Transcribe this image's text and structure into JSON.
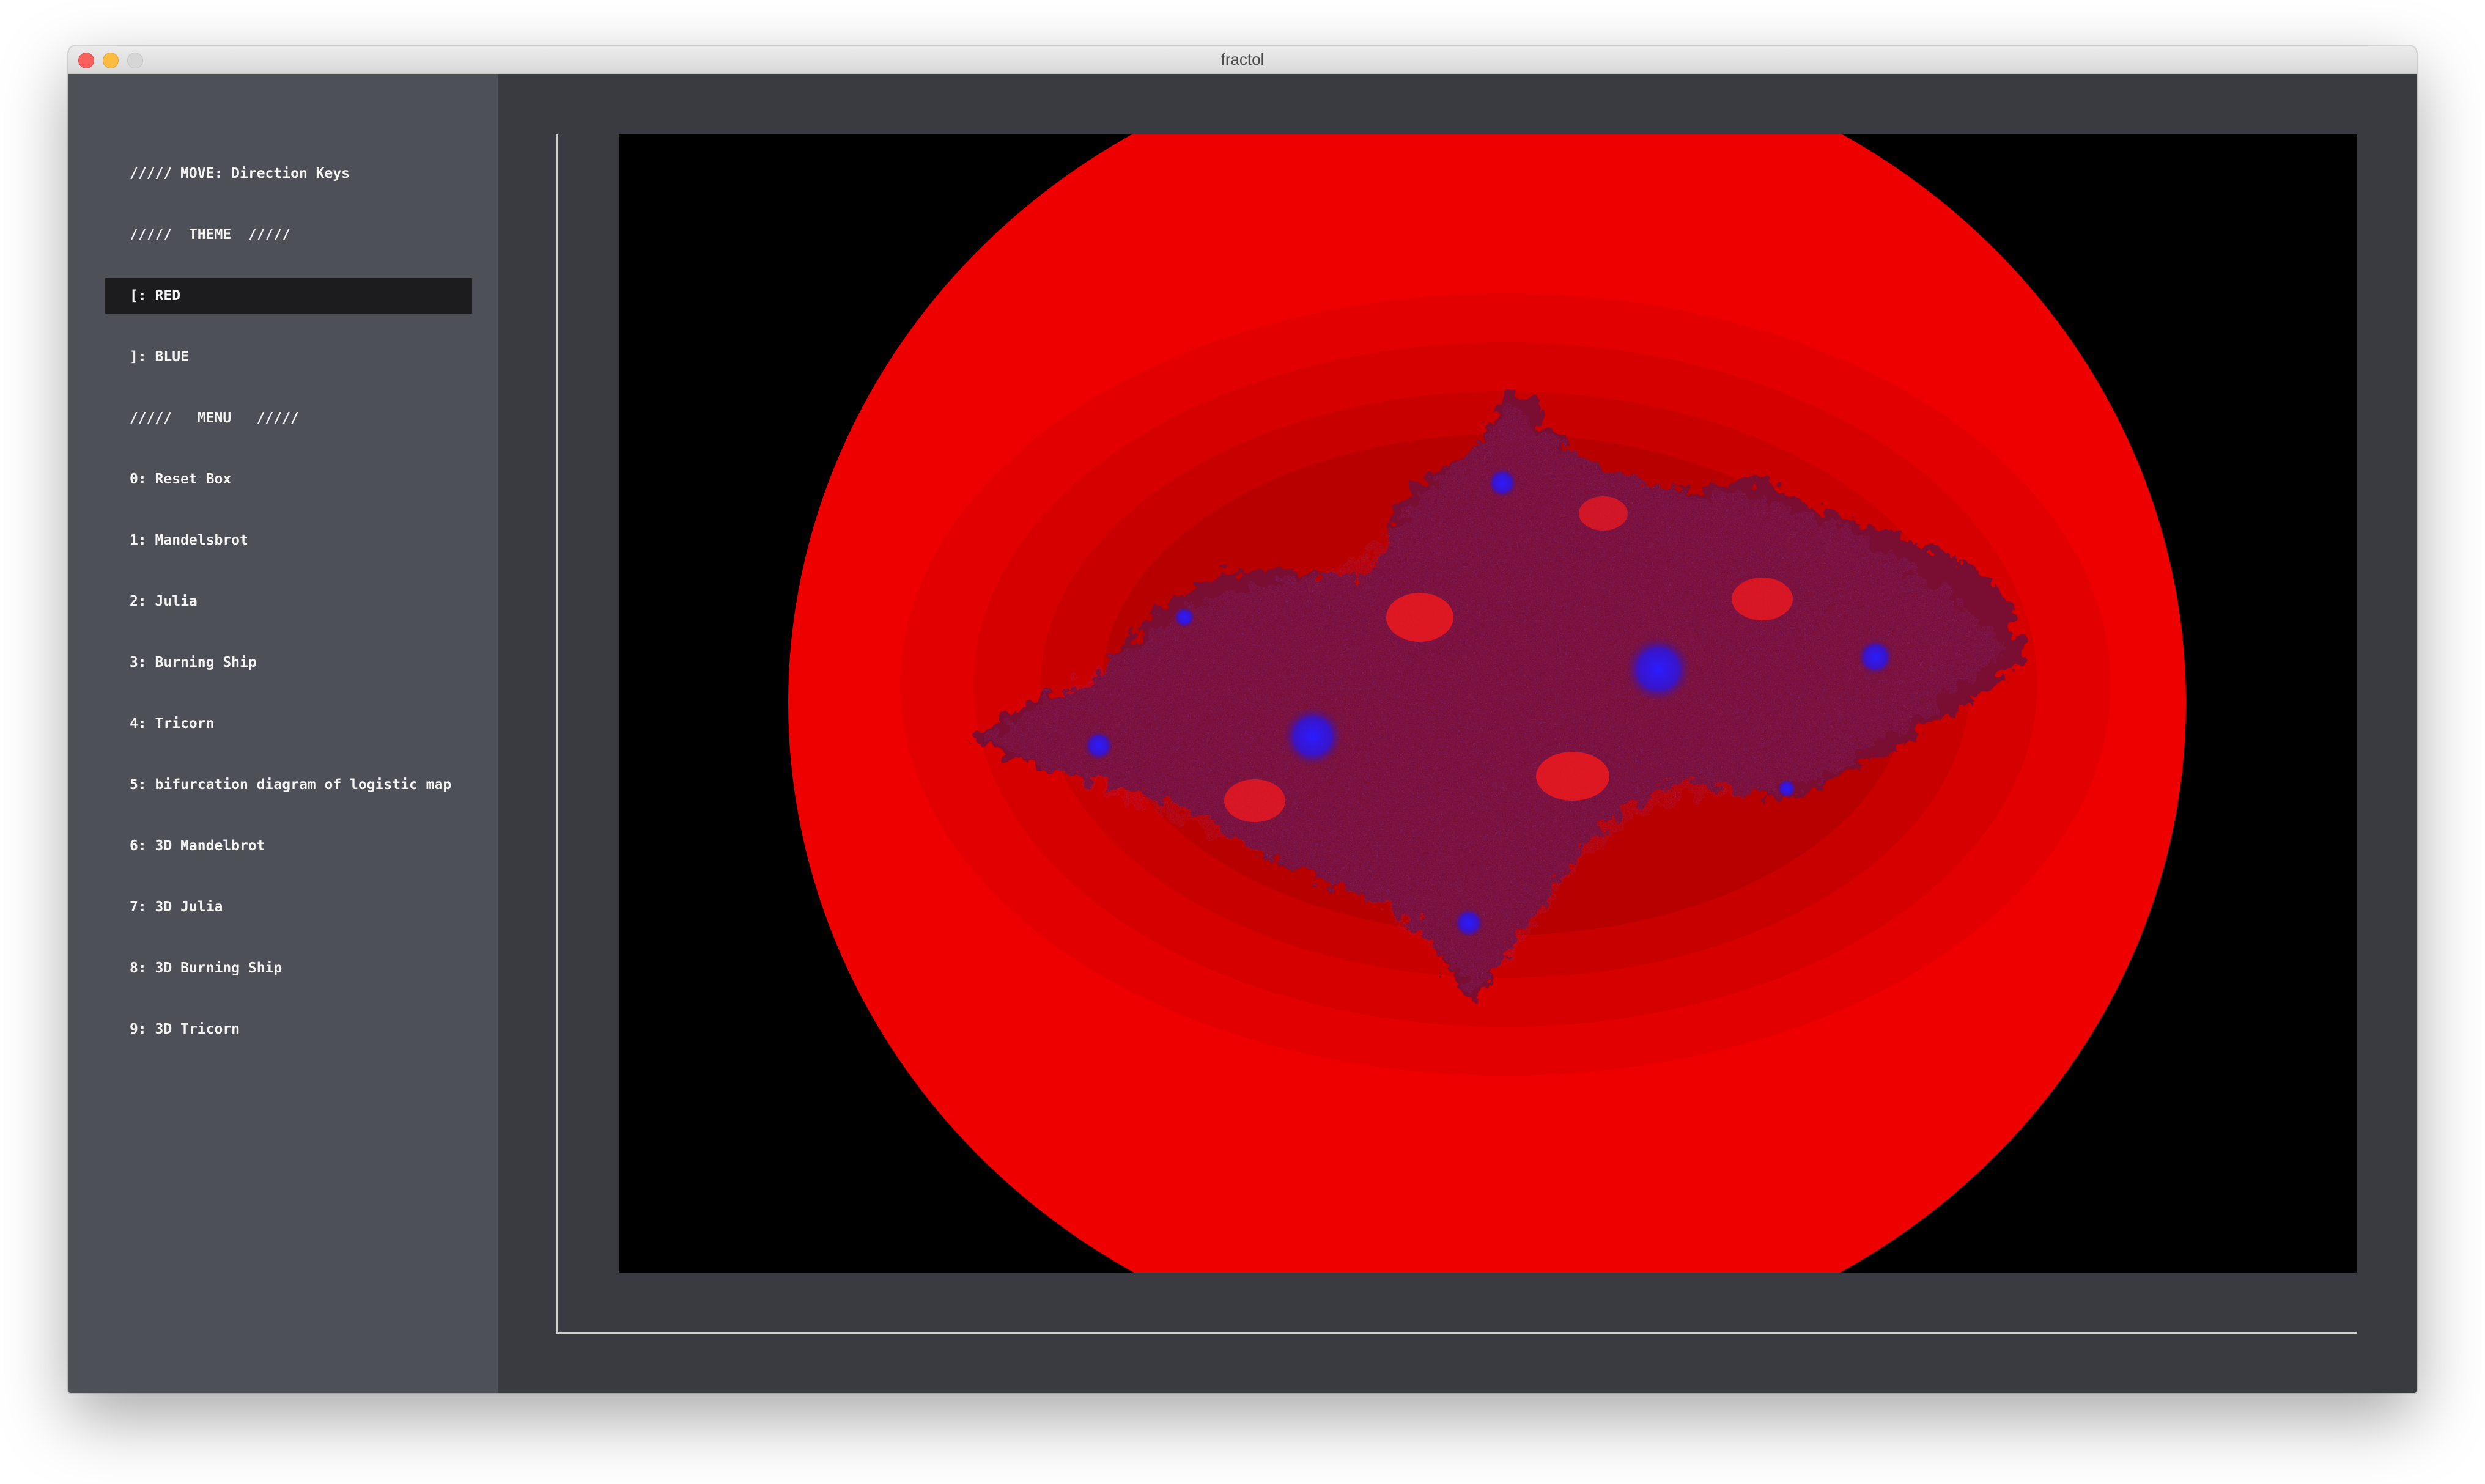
{
  "window": {
    "title": "fractol"
  },
  "sidebar": {
    "items": [
      {
        "label": "///// MOVE: Direction Keys",
        "selected": false
      },
      {
        "label": "/////  THEME  /////",
        "selected": false
      },
      {
        "label": "[: RED",
        "selected": true
      },
      {
        "label": "]: BLUE",
        "selected": false
      },
      {
        "label": "/////   MENU   /////",
        "selected": false
      },
      {
        "label": "0: Reset Box",
        "selected": false
      },
      {
        "label": "1: Mandelsbrot",
        "selected": false
      },
      {
        "label": "2: Julia",
        "selected": false
      },
      {
        "label": "3: Burning Ship",
        "selected": false
      },
      {
        "label": "4: Tricorn",
        "selected": false
      },
      {
        "label": "5: bifurcation diagram of logistic map",
        "selected": false
      },
      {
        "label": "6: 3D Mandelbrot",
        "selected": false
      },
      {
        "label": "7: 3D Julia",
        "selected": false
      },
      {
        "label": "8: 3D Burning Ship",
        "selected": false
      },
      {
        "label": "9: 3D Tricorn",
        "selected": false
      }
    ]
  },
  "canvas": {
    "fractal": "julia-set",
    "colors": {
      "background": "#000000",
      "outer": "#ee0000",
      "band1": "#e30000",
      "band2": "#d60000",
      "band3": "#c80000",
      "band4": "#b80000",
      "fractal_body": "#7a1030",
      "fractal_core": "#1a10e8"
    }
  }
}
